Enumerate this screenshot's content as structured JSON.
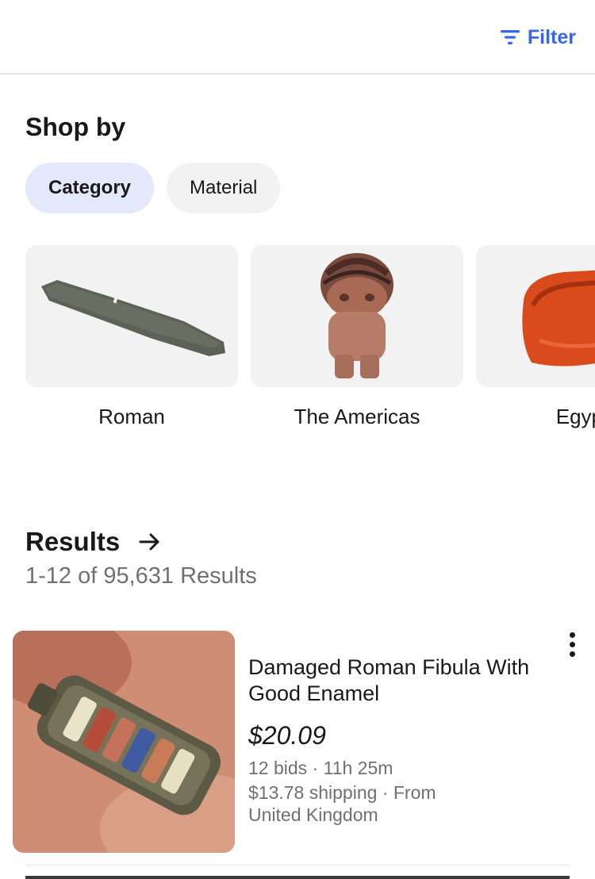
{
  "header": {
    "filter_label": "Filter",
    "filter_icon": "filter-lines-icon",
    "accent_color": "#3665f3"
  },
  "shop_by": {
    "title": "Shop by",
    "chips": [
      {
        "label": "Category",
        "selected": true
      },
      {
        "label": "Material",
        "selected": false
      }
    ]
  },
  "categories": [
    {
      "label": "Roman",
      "image": "roman-blade-artifact"
    },
    {
      "label": "The Americas",
      "image": "americas-clay-figurine"
    },
    {
      "label": "Egypt",
      "image": "egypt-red-stone-artifact"
    }
  ],
  "results": {
    "title": "Results",
    "arrow_icon": "arrow-right-icon",
    "count_text": "1-12 of 95,631 Results"
  },
  "items": [
    {
      "title": "Damaged Roman Fibula With Good Enamel",
      "price": "$20.09",
      "bids_time": "12 bids · 11h 25m",
      "shipping": "$13.78 shipping · From United Kingdom",
      "image": "roman-fibula-in-hand",
      "menu_icon": "more-vertical-icon"
    }
  ]
}
